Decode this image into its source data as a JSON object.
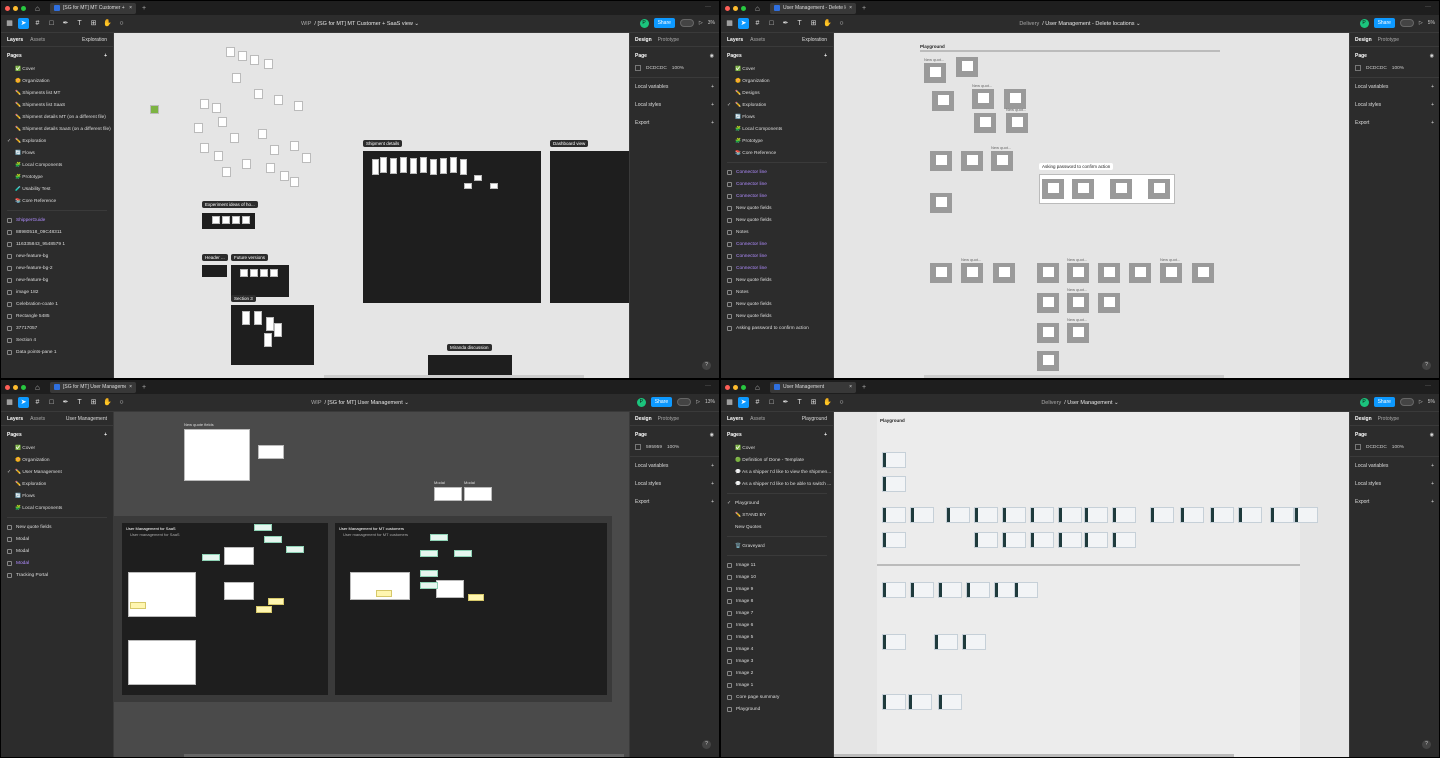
{
  "windows": [
    {
      "tab_title": "[SG for MT] MT Customer + SaaS",
      "project": "WIP",
      "file_name": "[SG for MT] MT Customer + SaaS view",
      "avatar": "P",
      "share": "Share",
      "zoom": "3%",
      "left_tabs": [
        "Layers",
        "Assets",
        "Exploration"
      ],
      "pages_label": "Pages",
      "pages": [
        "✅ Cover",
        "🌼 Organization",
        "✏️ Shipments list MT",
        "✏️ Shipments list SaaS",
        "✏️ Shipment details MT (on a different file)",
        "✏️ Shipment details SaaS (on a different file)",
        "✏️ Exploration",
        "🔄 Flows",
        "🧩 Local Components",
        "🧩 Prototype",
        "🧪 Usability Test",
        "📚 Core Reference"
      ],
      "selected_page": "✏️ Exploration",
      "layers": [
        "ShipperGuide",
        "88980518_09C48311",
        "116335843_9548579 1",
        "new-feature-bg",
        "new-feature-bg-2",
        "new-feature-bg",
        "image 182",
        "Celebration-coate 1",
        "Rectangle 5485",
        "37717057",
        "Section 4",
        "Data points-pane 1"
      ],
      "right_tabs": [
        "Design",
        "Prototype"
      ],
      "page_section": "Page",
      "page_color": "DCDCDC",
      "page_opacity": "100%",
      "sections": [
        "Local variables",
        "Local styles",
        "Export"
      ],
      "frames": [
        "Shipment details",
        "Dashboard view",
        "Experiment ideas of ho...",
        "Header ...",
        "Future versions",
        "Section 3",
        "Miranda discussion"
      ]
    },
    {
      "tab_title": "User Management - Delete locations",
      "project": "Delivery",
      "file_name": "User Management - Delete locations",
      "avatar": "P",
      "share": "Share",
      "zoom": "5%",
      "left_tabs": [
        "Layers",
        "Assets",
        "Exploration"
      ],
      "pages_label": "Pages",
      "pages": [
        "✅ Cover",
        "🌼 Organization",
        "✏️ Designs",
        "✏️ Exploration",
        "🔄 Flows",
        "🧩 Local Components",
        "🧩 Prototype",
        "📚 Core Reference"
      ],
      "selected_page": "✏️ Exploration",
      "layers": [
        "Connector line",
        "Connector line",
        "Connector line",
        "New quote fields",
        "New quote fields",
        "Notes",
        "Connector line",
        "Connector line",
        "Connector line",
        "New quote fields",
        "Notes",
        "New quote fields",
        "New quote fields",
        "Asking password to confirm action"
      ],
      "right_tabs": [
        "Design",
        "Prototype"
      ],
      "page_section": "Page",
      "page_color": "DCDCDC",
      "page_opacity": "100%",
      "sections": [
        "Local variables",
        "Local styles",
        "Export"
      ],
      "canvas_title": "Playground",
      "card_label": "New quot...",
      "asking": "Asking password to confirm action"
    },
    {
      "tab_title": "[SG for MT] User Management",
      "project": "WIP",
      "file_name": "[SG for MT] User Management",
      "avatar": "P",
      "share": "Share",
      "zoom": "13%",
      "left_tabs": [
        "Layers",
        "Assets",
        "User Management"
      ],
      "pages_label": "Pages",
      "pages": [
        "✅ Cover",
        "🌼 Organization",
        "✏️ User Management",
        "✏️ Exploration",
        "🔄 Flows",
        "🧩 Local Components"
      ],
      "selected_page": "✏️ User Management",
      "layers": [
        "New quote fields",
        "Modal",
        "Modal",
        "Modal",
        "Tracking Portal"
      ],
      "right_tabs": [
        "Design",
        "Prototype"
      ],
      "page_section": "Page",
      "page_color": "595959",
      "page_opacity": "100%",
      "sections": [
        "Local variables",
        "Local styles",
        "Export"
      ],
      "frames": [
        "New quote fields",
        "Modal",
        "Modal",
        "User Management for SaaS",
        "User Management for MT customers"
      ],
      "subs": [
        "User management for SaaS",
        "User management for MT customers"
      ]
    },
    {
      "tab_title": "User Management",
      "project": "Delivery",
      "file_name": "User Management",
      "avatar": "P",
      "share": "Share",
      "zoom": "5%",
      "left_tabs": [
        "Layers",
        "Assets",
        "Playground"
      ],
      "pages_label": "Pages",
      "pages": [
        "✅ Cover",
        "🟢 Definition of Done - Template",
        "💬 As a shipper I'd like to view the shipmen...",
        "💬 As a shipper I'd like to be able to switch ...",
        "—",
        "Playground",
        "✏️ STAND BY",
        "New Quotes",
        "—",
        "🗑️ Graveyard"
      ],
      "selected_page": "Playground",
      "layers": [
        "Image 11",
        "Image 10",
        "Image 9",
        "Image 8",
        "Image 7",
        "Image 6",
        "Image 5",
        "Image 4",
        "Image 3",
        "Image 2",
        "Image 1",
        "Core page summary",
        "Playground"
      ],
      "right_tabs": [
        "Design",
        "Prototype"
      ],
      "page_section": "Page",
      "page_color": "DCDCDC",
      "page_opacity": "100%",
      "sections": [
        "Local variables",
        "Local styles",
        "Export"
      ],
      "canvas_title": "Playground"
    }
  ]
}
